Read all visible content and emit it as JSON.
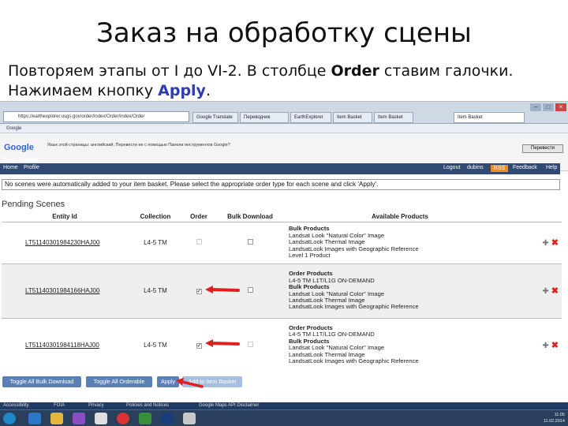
{
  "slide": {
    "title": "Заказ на обработку сцены",
    "line1_pre": "Повторяем этапы от I до VI-2. В столбце ",
    "line1_bold": "Order",
    "line1_post": " ставим галочки.",
    "line2_pre": "Нажимаем кнопку ",
    "line2_bold": "Apply",
    "line2_post": "."
  },
  "browser": {
    "address": "https://earthexplorer.usgs.gov/order/index/Order/index/Order",
    "tabs": [
      "Google Translate",
      "Переводчик",
      "EarthExplorer",
      "Item Basket",
      "Item Basket",
      "Item Basket"
    ],
    "bookmarks": "Google",
    "google_label": "Google",
    "translate_notice": "Язык этой страницы: английский. Перевести ее с помощью Панели инструментов Google?",
    "translate_button": "Перевести"
  },
  "site": {
    "section_title": "Item Basket",
    "nav": {
      "home": "Home",
      "profile": "Profile",
      "logout": "Logout",
      "user": "dubins",
      "rss": "RSS",
      "feedback": "Feedback",
      "help": "Help"
    },
    "notice": "No scenes were automatically added to your item basket. Please select the appropriate order type for each scene and click 'Apply'.",
    "pending_title": "Pending Scenes",
    "columns": [
      "Entity Id",
      "Collection",
      "Order",
      "Bulk Download",
      "Available Products"
    ]
  },
  "rows": [
    {
      "entity_id": "LT51140301984230HAJ00",
      "collection": "L4-5 TM",
      "order_checked": false,
      "bulk_checked": false,
      "products": [
        "Bulk Products",
        "Landsat Look \"Natural Color\" Image",
        "LandsatLook Thermal Image",
        "LandsatLook Images with Geographic Reference",
        "Level 1 Product"
      ]
    },
    {
      "entity_id": "LT51140301984166HAJ00",
      "collection": "L4-5 TM",
      "order_checked": true,
      "bulk_checked": false,
      "products": [
        "Order Products",
        "L4-5 TM L1T/L1G ON-DEMAND",
        "Bulk Products",
        "Landsat Look \"Natural Color\" Image",
        "LandsatLook Thermal Image",
        "LandsatLook Images with Geographic Reference"
      ]
    },
    {
      "entity_id": "LT51140301984118HAJ00",
      "collection": "L4-5 TM",
      "order_checked": true,
      "bulk_checked": false,
      "products": [
        "Order Products",
        "L4-5 TM L1T/L1G ON-DEMAND",
        "Bulk Products",
        "Landsat Look \"Natural Color\" Image",
        "LandsatLook Thermal Image",
        "LandsatLook Images with Geographic Reference"
      ]
    }
  ],
  "buttons": {
    "toggle_bulk": "Toggle All Bulk Download",
    "toggle_orderable": "Toggle All Orderable",
    "apply": "Apply",
    "add_to_basket": "Add to Item Basket"
  },
  "footer": [
    "Accessibility",
    "FOIA",
    "Privacy",
    "Policies and Notices",
    "Google Maps API Disclaimer"
  ],
  "tray": {
    "time": "11:05",
    "date": "11.02.2014"
  },
  "colors": {
    "accent": "#2b3db0",
    "nav": "#304a73",
    "button": "#5b80b6",
    "arrow": "#e02020"
  }
}
